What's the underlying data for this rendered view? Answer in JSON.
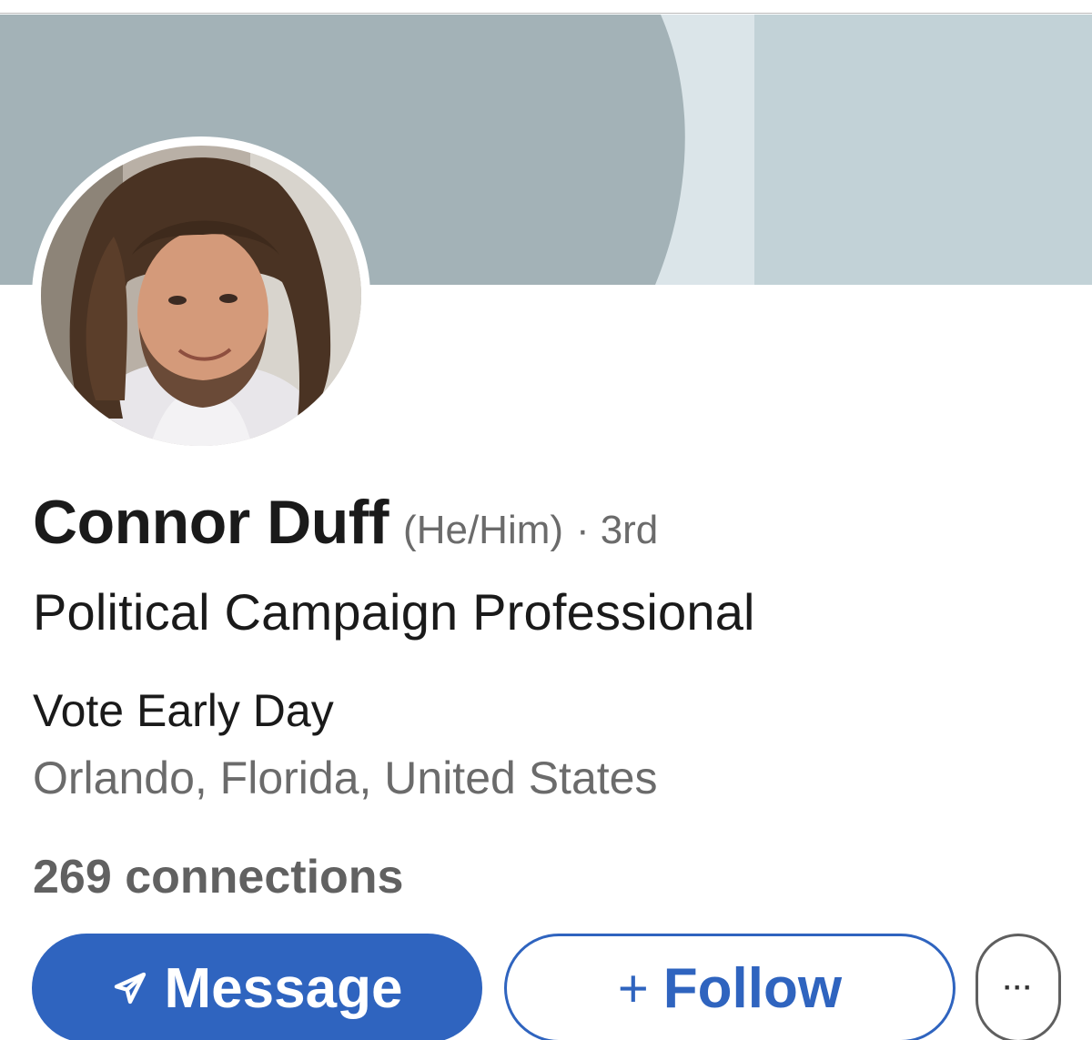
{
  "profile": {
    "name": "Connor Duff",
    "pronouns": "(He/Him)",
    "separator": "·",
    "connection_degree": "3rd",
    "headline": "Political Campaign Professional",
    "company": "Vote Early Day",
    "location": "Orlando, Florida, United States",
    "connections": "269 connections"
  },
  "actions": {
    "message_label": "Message",
    "message_icon": "send-icon",
    "follow_plus": "+",
    "follow_label": "Follow",
    "more_label": "···",
    "more_icon": "more-icon"
  },
  "colors": {
    "accent": "#2f64bf",
    "cover_main": "#a3b2b7",
    "cover_light": "#c2d2d7",
    "cover_stripe": "#dbe5e9",
    "text_primary": "#1a1a1a",
    "text_secondary": "#6b6b6b"
  }
}
